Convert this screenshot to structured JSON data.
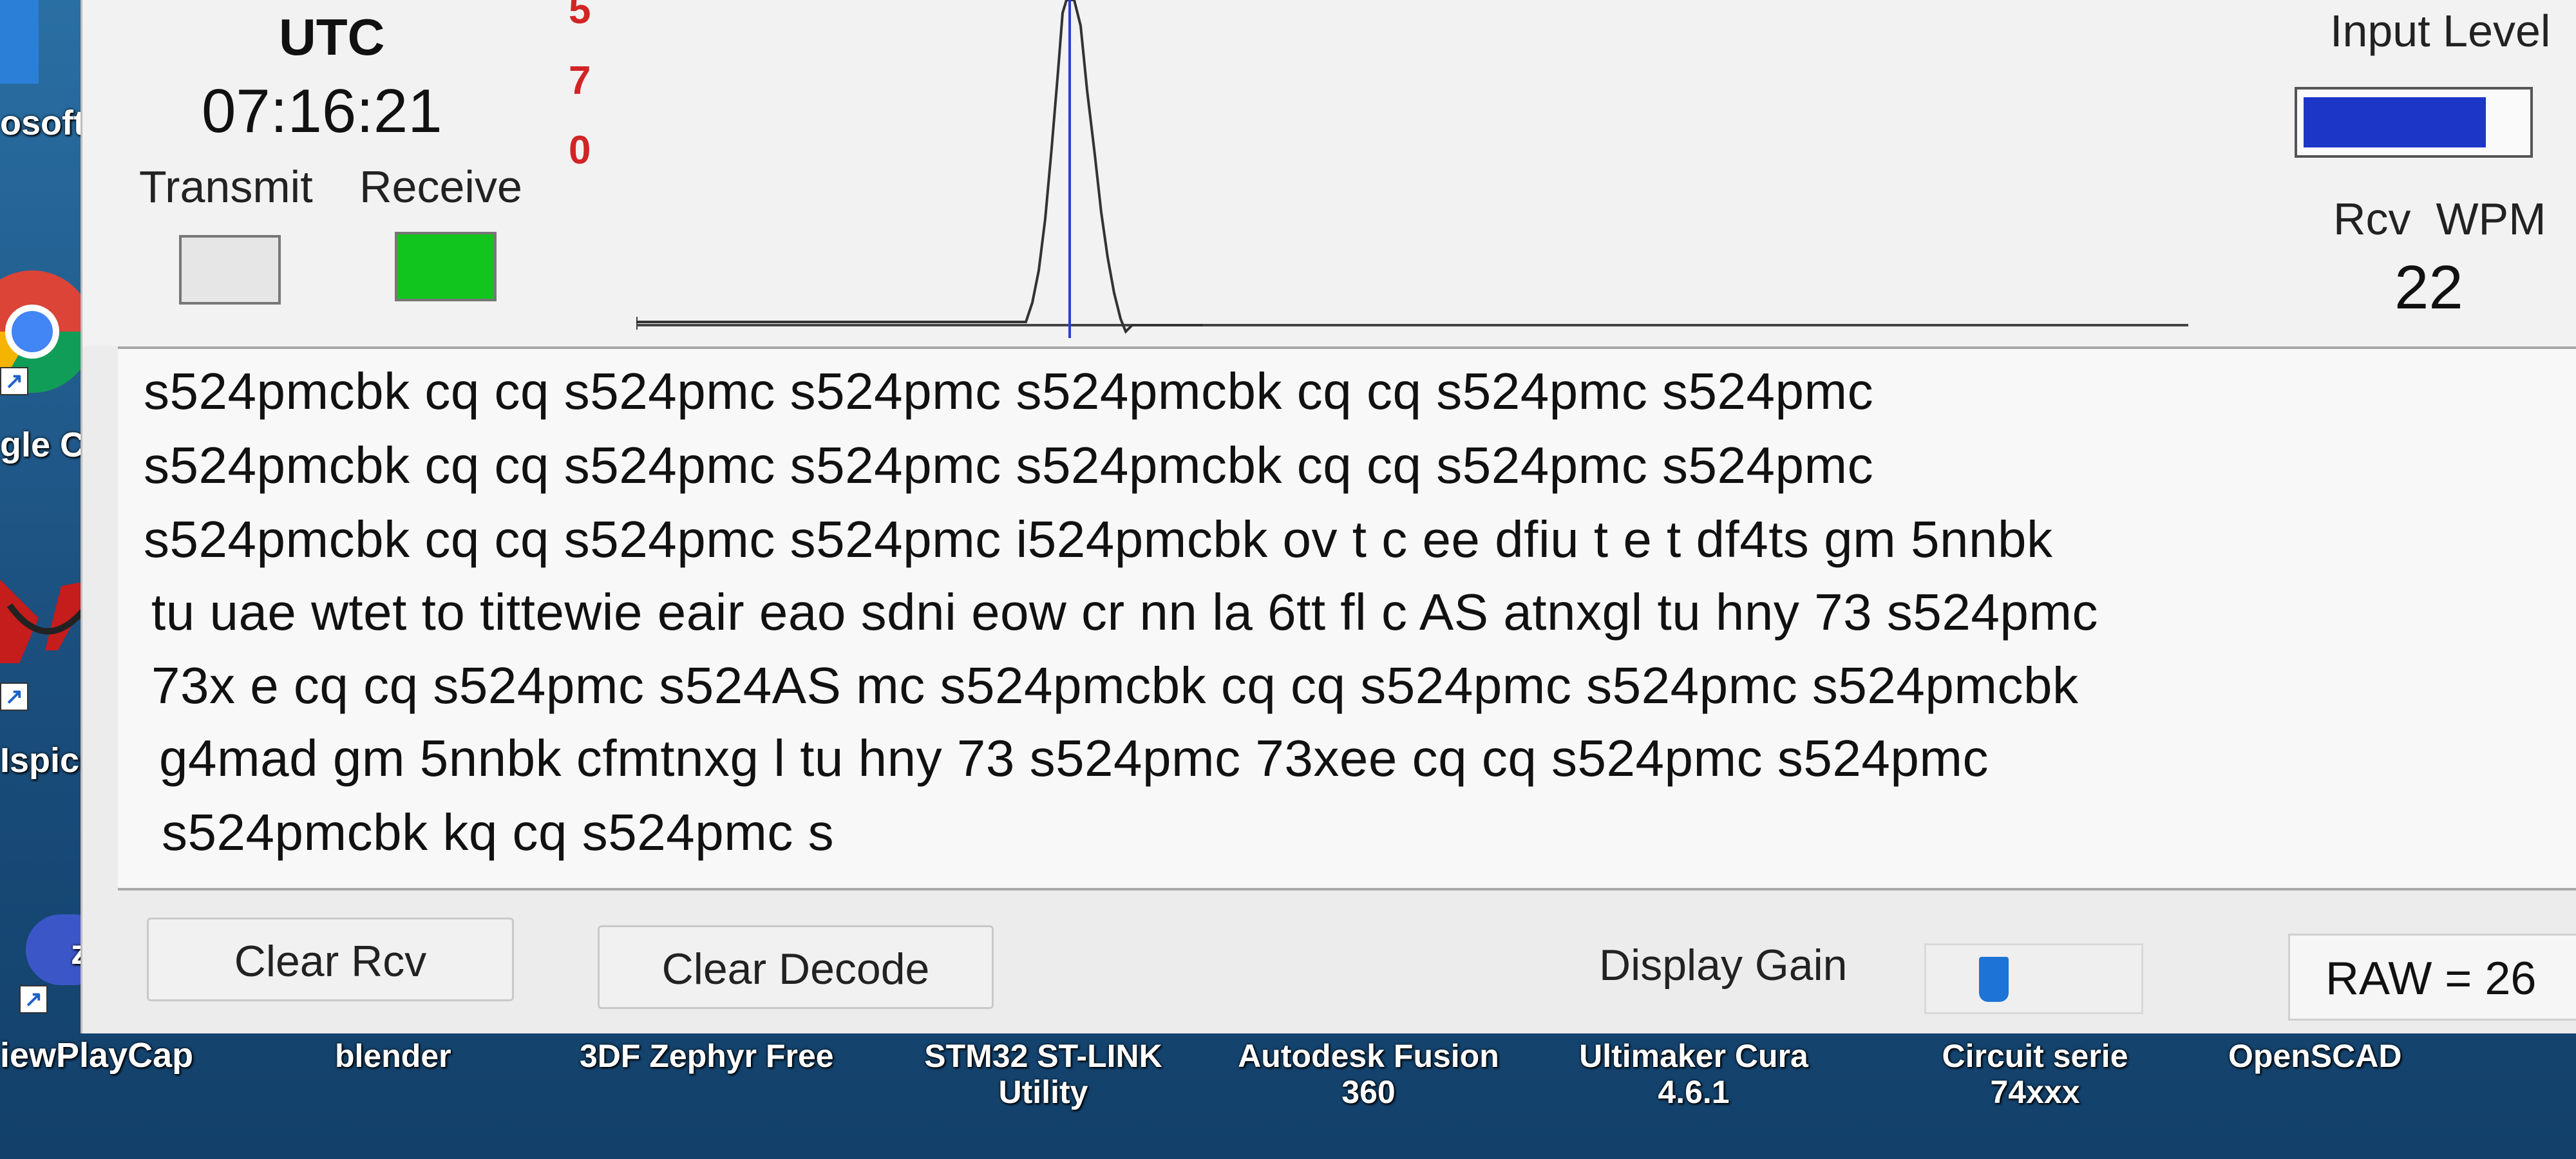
{
  "desktop": {
    "left_labels": [
      "osoft",
      "gle C",
      "Ispice",
      "zo",
      "iewPlayCap"
    ],
    "bottom_labels": [
      "blender",
      "3DF Zephyr Free",
      "STM32 ST-LINK Utility",
      "Autodesk Fusion 360",
      "Ultimaker Cura 4.6.1",
      "Circuit serie 74xxx",
      "OpenSCAD"
    ]
  },
  "header": {
    "utc_title": "UTC",
    "utc_time": "07:16:21",
    "transmit_label": "Transmit",
    "receive_label": "Receive",
    "receive_led_color": "#12c41e",
    "transmit_led_color": "#e6e6e6",
    "scale_digits": [
      "5",
      "7",
      "0"
    ],
    "input_level_label": "Input Level",
    "input_level_fraction": 0.82,
    "rcv_label": "Rcv",
    "wpm_label": "WPM",
    "rcv_wpm_value": "22"
  },
  "decode": {
    "lines": [
      "s524pmcbk cq cq s524pmc s524pmc s524pmcbk cq cq s524pmc s524pmc",
      "s524pmcbk cq cq s524pmc s524pmc s524pmcbk cq cq s524pmc s524pmc",
      "s524pmcbk cq cq s524pmc s524pmc i524pmcbk ov  t c    ee dfiu t e t df4ts gm 5nnbk",
      "tu uae wtet to tittewie eair eao sdni eow cr nn la 6tt  fl  c AS atnxgl tu hny 73 s524pmc",
      "73x e cq cq s524pmc s524AS mc s524pmcbk cq cq s524pmc s524pmc s524pmcbk",
      "g4mad gm 5nnbk cfmtnxg l tu hny 73 s524pmc 73xee cq cq s524pmc s524pmc",
      "s524pmcbk kq cq s524pmc s"
    ]
  },
  "controls": {
    "clear_rcv": "Clear Rcv",
    "clear_decode": "Clear Decode",
    "display_gain_label": "Display Gain",
    "display_gain_fraction": 0.28,
    "raw_text": "RAW = 26"
  },
  "colors": {
    "accent_blue": "#1c36c8",
    "slider_blue": "#1d74d6",
    "scale_red": "#d22424"
  }
}
